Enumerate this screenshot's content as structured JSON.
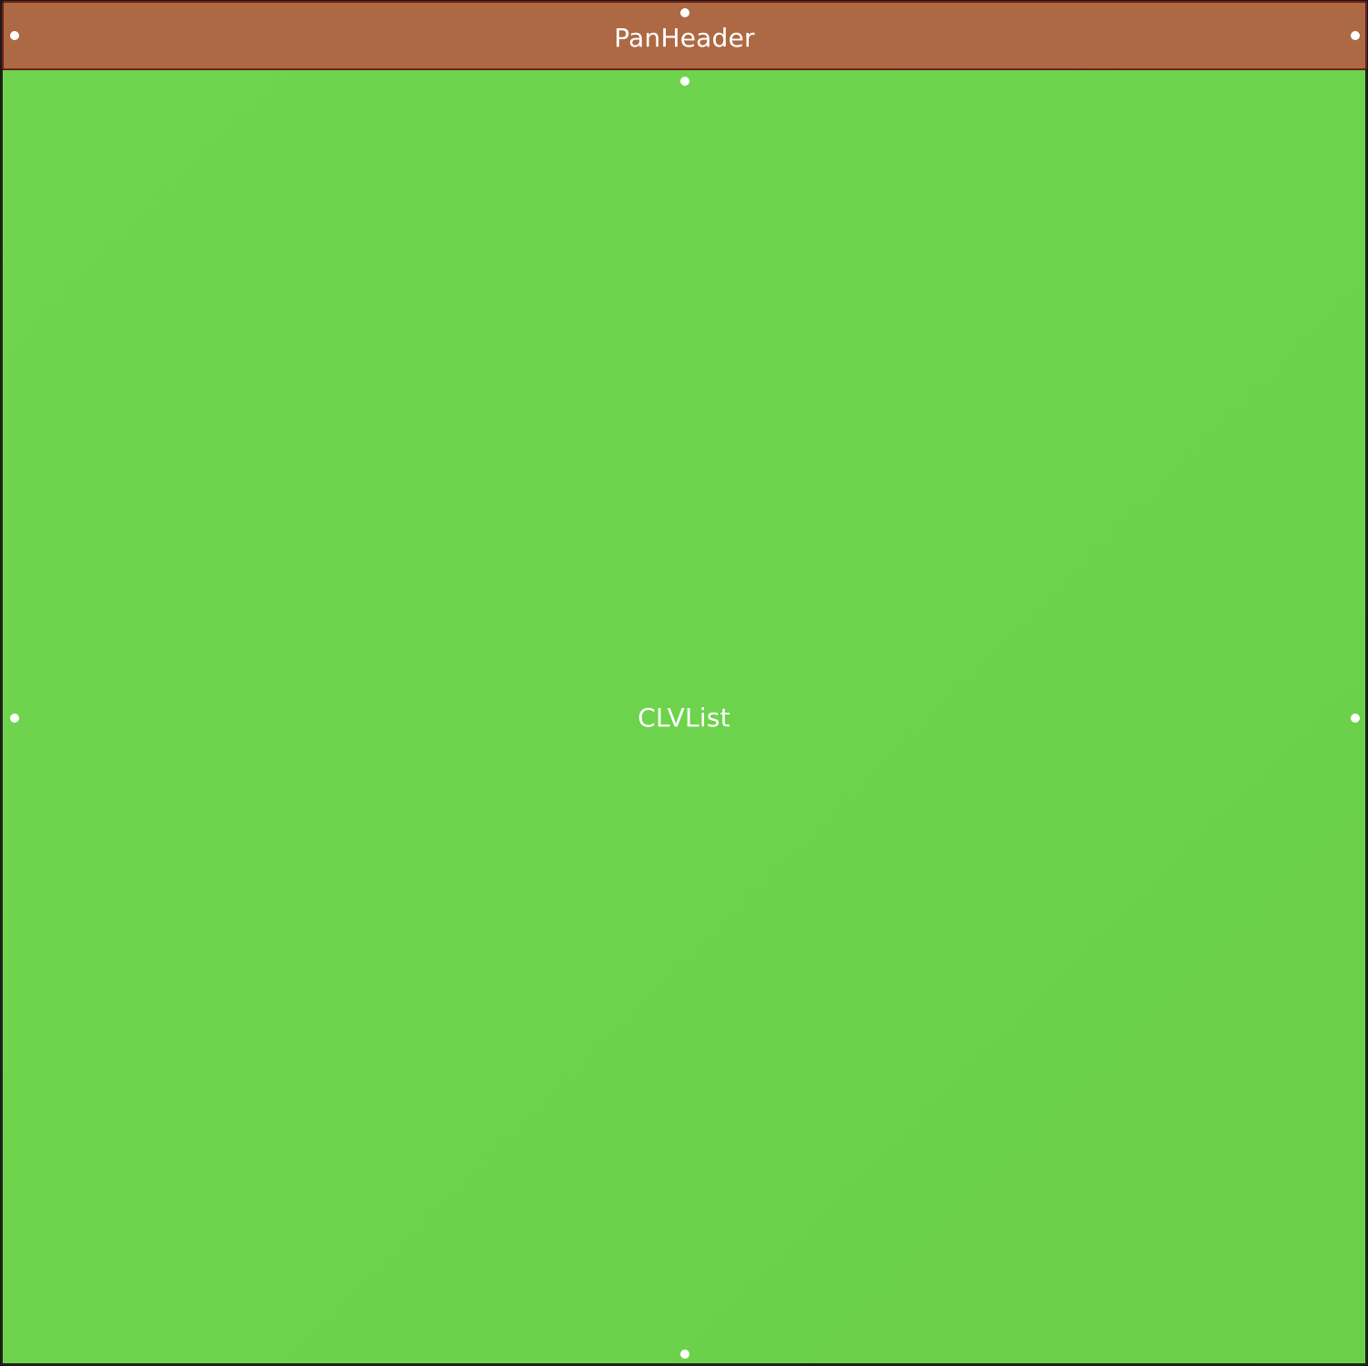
{
  "views": {
    "pan_header": {
      "label": "PanHeader",
      "color": "#ad6943",
      "border_color": "#6e1f17"
    },
    "clv_list": {
      "label": "CLVList",
      "color": "#6dd34c"
    }
  }
}
